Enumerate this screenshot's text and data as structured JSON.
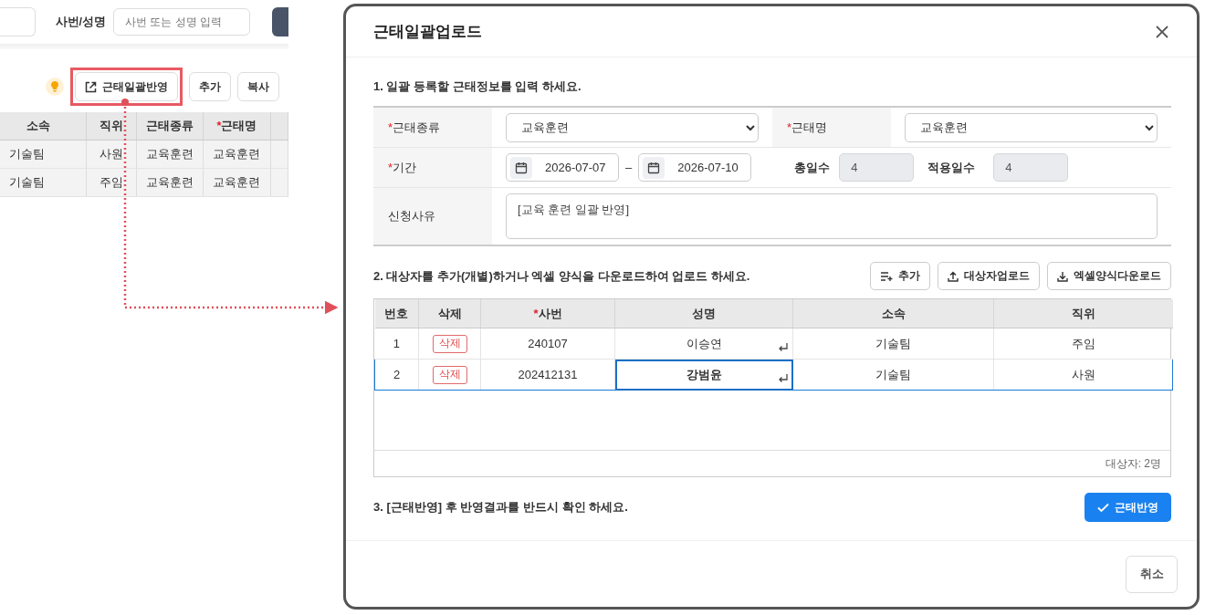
{
  "background_page": {
    "search_label": "사번/성명",
    "search_placeholder": "사번 또는 성명 입력",
    "toolbar_buttons": [
      {
        "label": "근태일괄반영",
        "kind": "bulk",
        "highlighted": true
      },
      {
        "label": "추가",
        "kind": "plain",
        "highlighted": false
      },
      {
        "label": "복사",
        "kind": "plain",
        "highlighted": false
      }
    ],
    "table": {
      "columns": [
        {
          "label": "소속"
        },
        {
          "label": "직위"
        },
        {
          "label": "근태종류"
        },
        {
          "label": "근태명",
          "required_mark": "*"
        }
      ],
      "rows": [
        [
          "기술팀",
          "사원",
          "교육훈련",
          "교육훈련"
        ],
        [
          "기술팀",
          "주임",
          "교육훈련",
          "교육훈련"
        ]
      ]
    }
  },
  "dialog": {
    "title": "근태일괄업로드",
    "section_1": {
      "heading": "1. 일괄 등록할 근태정보를 입력 하세요.",
      "attendance_type": {
        "label": "근태종류",
        "required_mark": "*",
        "value": "교육훈련"
      },
      "attendance_name": {
        "label": "근태명",
        "required_mark": "*",
        "value": "교육훈련"
      },
      "period": {
        "label": "기간",
        "required_mark": "*",
        "start": "2026-07-07",
        "separator": "–",
        "end": "2026-07-10"
      },
      "total_days": {
        "label": "총일수",
        "value": "4"
      },
      "applied_days": {
        "label": "적용일수",
        "value": "4"
      },
      "reason": {
        "label": "신청사유",
        "value": "[교육 훈련 일괄 반영]"
      }
    },
    "section_2": {
      "heading": "2. 대상자를 추가(개별)하거나 엑셀 양식을 다운로드하여 업로드 하세요.",
      "buttons": [
        {
          "label": "추가",
          "kind": "add"
        },
        {
          "label": "대상자업로드",
          "kind": "upload"
        },
        {
          "label": "엑셀양식다운로드",
          "kind": "download"
        }
      ],
      "columns": [
        {
          "label": "번호"
        },
        {
          "label": "삭제"
        },
        {
          "label": "사번",
          "required_mark": "*"
        },
        {
          "label": "성명"
        },
        {
          "label": "소속"
        },
        {
          "label": "직위"
        }
      ],
      "rows": [
        {
          "no": "1",
          "delete": "삭제",
          "employee_id": "240107",
          "name": "이승연",
          "department": "기술팀",
          "position": "주임",
          "selected": false
        },
        {
          "no": "2",
          "delete": "삭제",
          "employee_id": "202412131",
          "name": "강범윤",
          "department": "기술팀",
          "position": "사원",
          "selected": true
        }
      ],
      "count": "대상자: 2명"
    },
    "section_3": {
      "heading": "3. [근태반영] 후 반영결과를 반드시 확인 하세요.",
      "apply_button": "근태반영"
    },
    "cancel_button": "취소"
  }
}
